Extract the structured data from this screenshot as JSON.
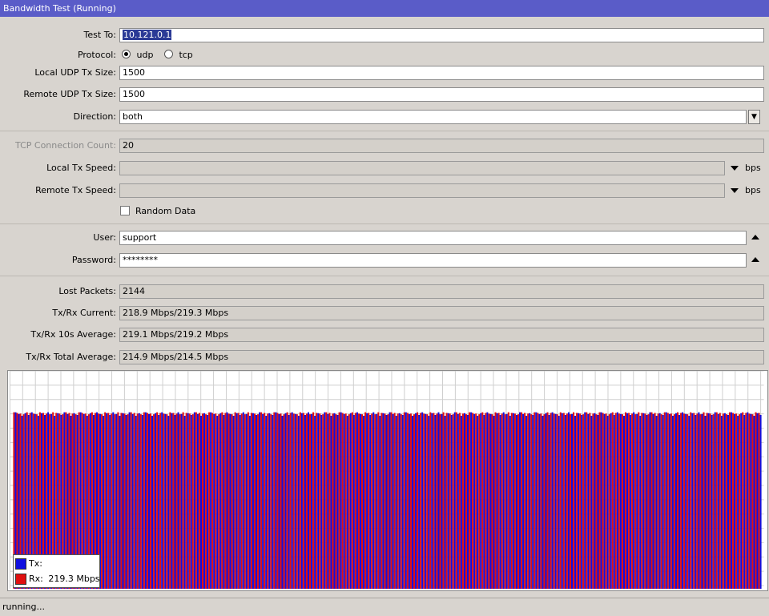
{
  "window": {
    "title": "Bandwidth Test (Running)"
  },
  "form": {
    "test_to": {
      "label": "Test To:",
      "value": "10.121.0.1"
    },
    "protocol": {
      "label": "Protocol:",
      "options": [
        "udp",
        "tcp"
      ],
      "selected": "udp"
    },
    "local_udp_tx_size": {
      "label": "Local UDP Tx Size:",
      "value": "1500"
    },
    "remote_udp_tx_size": {
      "label": "Remote UDP Tx Size:",
      "value": "1500"
    },
    "direction": {
      "label": "Direction:",
      "value": "both"
    },
    "tcp_connection_count": {
      "label": "TCP Connection Count:",
      "value": "20"
    },
    "local_tx_speed": {
      "label": "Local Tx Speed:",
      "value": "",
      "unit": "bps"
    },
    "remote_tx_speed": {
      "label": "Remote Tx Speed:",
      "value": "",
      "unit": "bps"
    },
    "random_data": {
      "label": "Random Data",
      "checked": false
    },
    "user": {
      "label": "User:",
      "value": "support"
    },
    "password": {
      "label": "Password:",
      "value": "********"
    }
  },
  "stats": {
    "lost_packets": {
      "label": "Lost Packets:",
      "value": "2144"
    },
    "current": {
      "label": "Tx/Rx Current:",
      "value": "218.9 Mbps/219.3 Mbps"
    },
    "avg_10s": {
      "label": "Tx/Rx 10s Average:",
      "value": "219.1 Mbps/219.2 Mbps"
    },
    "total_avg": {
      "label": "Tx/Rx Total Average:",
      "value": "214.9 Mbps/214.5 Mbps"
    }
  },
  "legend": {
    "tx": {
      "label": "Tx:",
      "color": "#1010e0"
    },
    "rx": {
      "label": "Rx:",
      "value": "219.3 Mbps",
      "color": "#e01010"
    }
  },
  "status": {
    "text": "running..."
  },
  "chart_data": {
    "type": "bar",
    "series": [
      {
        "name": "Tx",
        "level": 0.81,
        "bars": 230
      },
      {
        "name": "Rx",
        "level": 0.81,
        "bars": 230
      }
    ],
    "grid": true
  }
}
